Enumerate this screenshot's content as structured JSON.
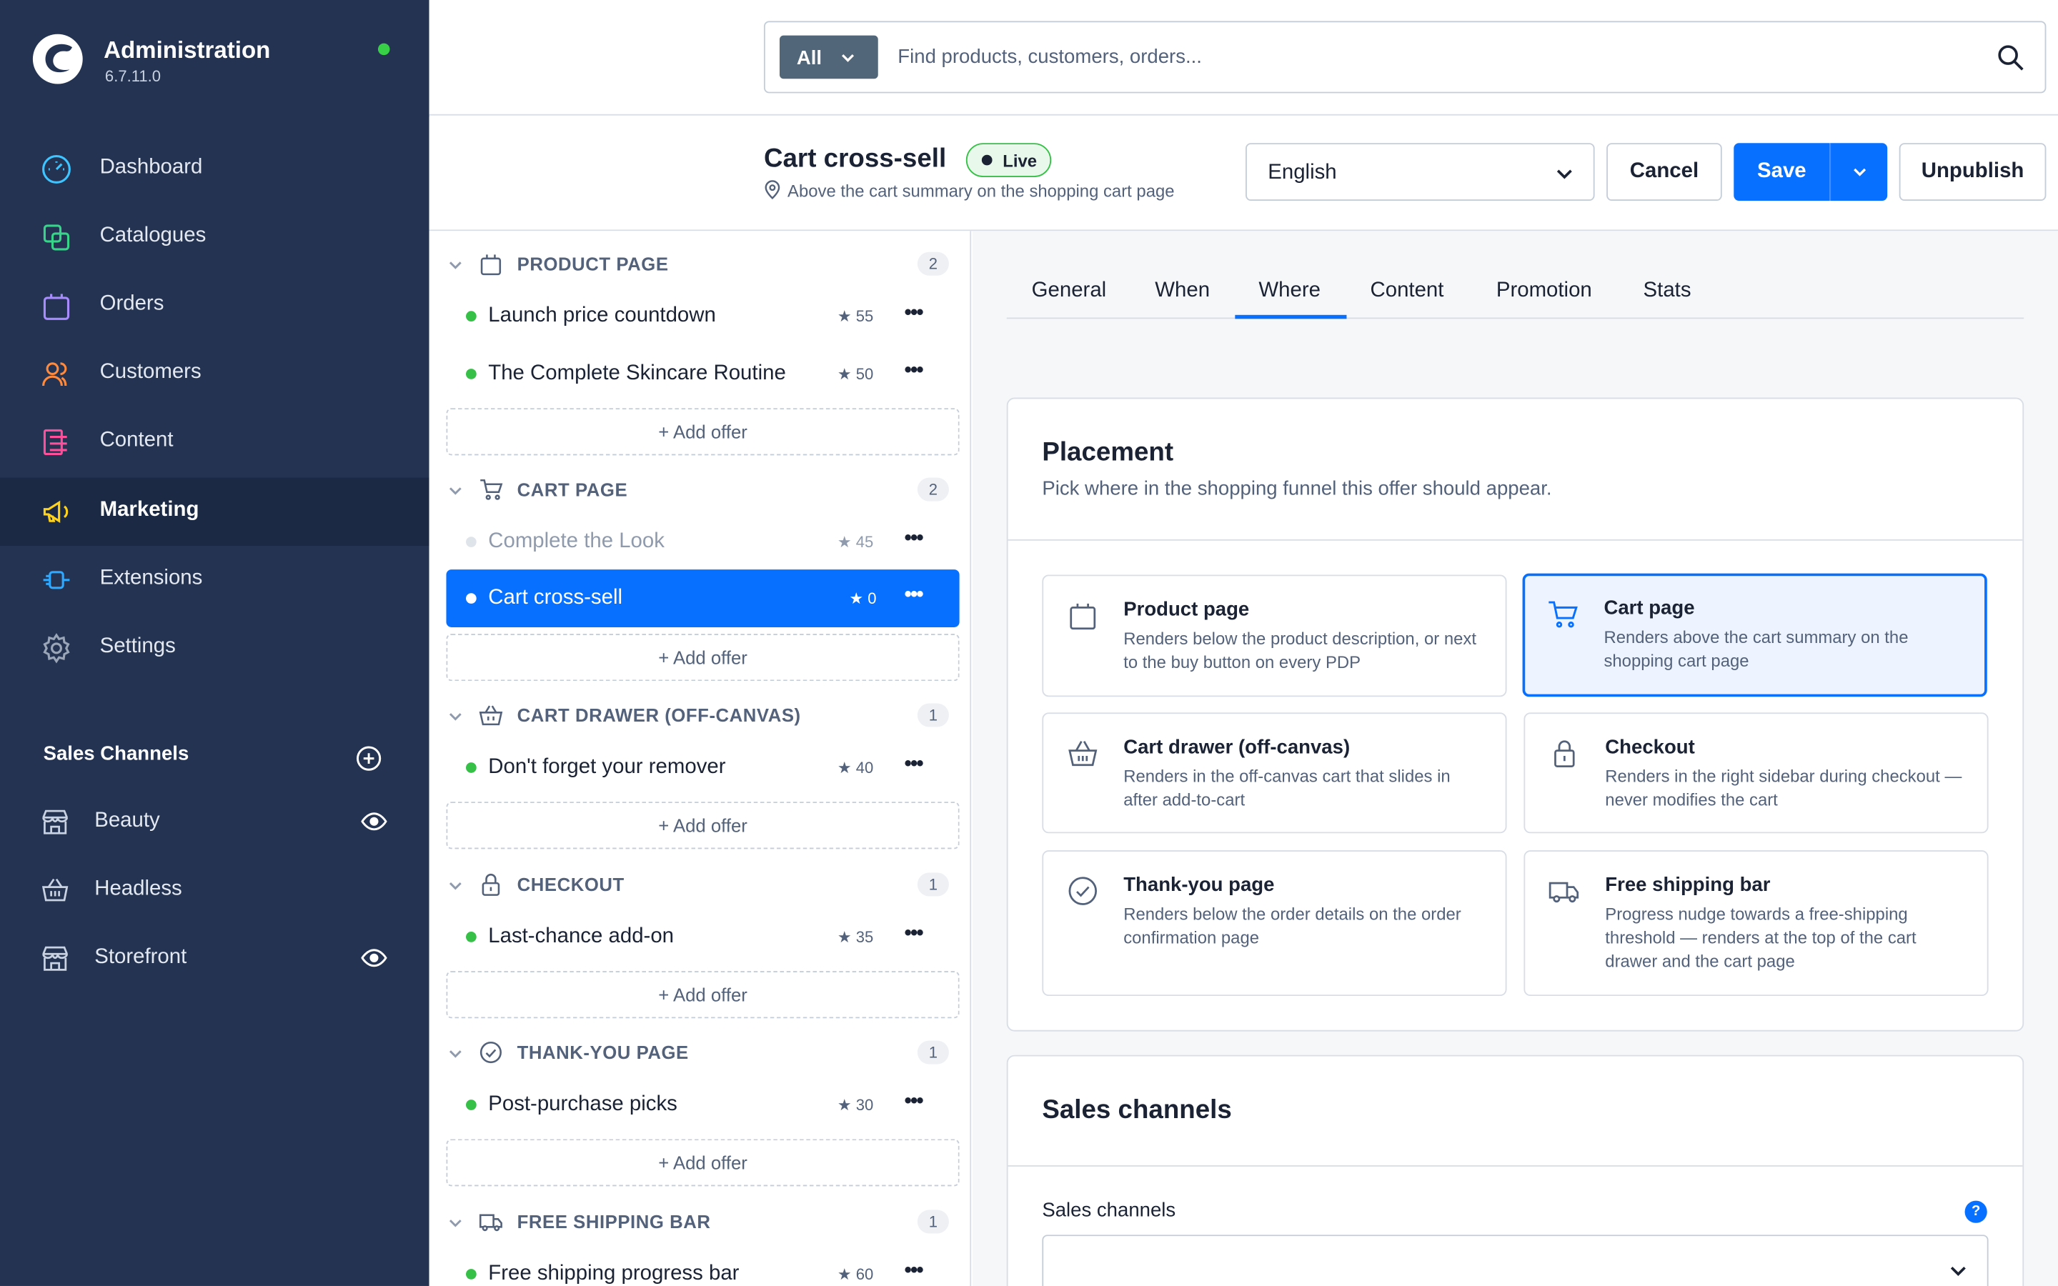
{
  "app": {
    "title": "Administration",
    "version": "6.7.11.0"
  },
  "nav": [
    {
      "label": "Dashboard",
      "icon": "gauge-icon",
      "color": "#3ec4ff"
    },
    {
      "label": "Catalogues",
      "icon": "catalogue-icon",
      "color": "#38d48a"
    },
    {
      "label": "Orders",
      "icon": "bag-icon",
      "color": "#a88bff"
    },
    {
      "label": "Customers",
      "icon": "users-icon",
      "color": "#ff8a3d"
    },
    {
      "label": "Content",
      "icon": "content-icon",
      "color": "#ff4f9a"
    },
    {
      "label": "Marketing",
      "icon": "megaphone-icon",
      "color": "#ffd21a",
      "active": true
    },
    {
      "label": "Extensions",
      "icon": "plug-icon",
      "color": "#2fa8ff"
    },
    {
      "label": "Settings",
      "icon": "gear-icon",
      "color": "#9aa6b8"
    }
  ],
  "sales_channels": {
    "heading": "Sales Channels",
    "items": [
      {
        "label": "Beauty",
        "icon": "storefront-icon",
        "visible_icon": true
      },
      {
        "label": "Headless",
        "icon": "basket-icon",
        "visible_icon": false
      },
      {
        "label": "Storefront",
        "icon": "storefront-icon",
        "visible_icon": true
      }
    ]
  },
  "search": {
    "scope": "All",
    "placeholder": "Find products, customers, orders..."
  },
  "header": {
    "title": "Cart cross-sell",
    "status": "Live",
    "subtitle": "Above the cart summary on the shopping cart page",
    "language": "English",
    "cancel": "Cancel",
    "save": "Save",
    "unpublish": "Unpublish"
  },
  "groups": [
    {
      "label": "PRODUCT PAGE",
      "icon": "bag-icon",
      "count": "2",
      "offers": [
        {
          "label": "Launch price countdown",
          "rating": "★ 55",
          "state": "active"
        },
        {
          "label": "The Complete Skincare Routine",
          "rating": "★ 50",
          "state": "active"
        }
      ],
      "add_label": "+ Add offer"
    },
    {
      "label": "CART PAGE",
      "icon": "cart-icon",
      "count": "2",
      "offers": [
        {
          "label": "Complete the Look",
          "rating": "★ 45",
          "state": "inactive"
        },
        {
          "label": "Cart cross-sell",
          "rating": "★ 0",
          "state": "selected"
        }
      ],
      "add_label": "+ Add offer"
    },
    {
      "label": "CART DRAWER (OFF-CANVAS)",
      "icon": "basket-icon",
      "count": "1",
      "offers": [
        {
          "label": "Don't forget your remover",
          "rating": "★ 40",
          "state": "active"
        }
      ],
      "add_label": "+ Add offer"
    },
    {
      "label": "CHECKOUT",
      "icon": "lock-icon",
      "count": "1",
      "offers": [
        {
          "label": "Last-chance add-on",
          "rating": "★ 35",
          "state": "active"
        }
      ],
      "add_label": "+ Add offer"
    },
    {
      "label": "THANK-YOU PAGE",
      "icon": "check-circle-icon",
      "count": "1",
      "offers": [
        {
          "label": "Post-purchase picks",
          "rating": "★ 30",
          "state": "active"
        }
      ],
      "add_label": "+ Add offer"
    },
    {
      "label": "FREE SHIPPING BAR",
      "icon": "truck-icon",
      "count": "1",
      "offers": [
        {
          "label": "Free shipping progress bar",
          "rating": "★ 60",
          "state": "active"
        }
      ]
    }
  ],
  "tabs": [
    {
      "label": "General"
    },
    {
      "label": "When"
    },
    {
      "label": "Where",
      "active": true
    },
    {
      "label": "Content"
    },
    {
      "label": "Promotion"
    },
    {
      "label": "Stats"
    }
  ],
  "placement": {
    "title": "Placement",
    "subtitle": "Pick where in the shopping funnel this offer should appear.",
    "options": [
      {
        "title": "Product page",
        "desc": "Renders below the product description, or next to the buy button on every PDP",
        "icon": "bag-icon"
      },
      {
        "title": "Cart page",
        "desc": "Renders above the cart summary on the shopping cart page",
        "icon": "cart-icon",
        "selected": true
      },
      {
        "title": "Cart drawer (off-canvas)",
        "desc": "Renders in the off-canvas cart that slides in after add-to-cart",
        "icon": "basket-icon"
      },
      {
        "title": "Checkout",
        "desc": "Renders in the right sidebar during checkout — never modifies the cart",
        "icon": "lock-icon"
      },
      {
        "title": "Thank-you page",
        "desc": "Renders below the order details on the order confirmation page",
        "icon": "check-circle-icon"
      },
      {
        "title": "Free shipping bar",
        "desc": "Progress nudge towards a free-shipping threshold — renders at the top of the cart drawer and the cart page",
        "icon": "truck-icon"
      }
    ]
  },
  "sales_card": {
    "title": "Sales channels",
    "field_label": "Sales channels",
    "help": "?"
  },
  "colors": {
    "sidebar": "#233351",
    "accent": "#0870ff",
    "live": "#37c048"
  }
}
